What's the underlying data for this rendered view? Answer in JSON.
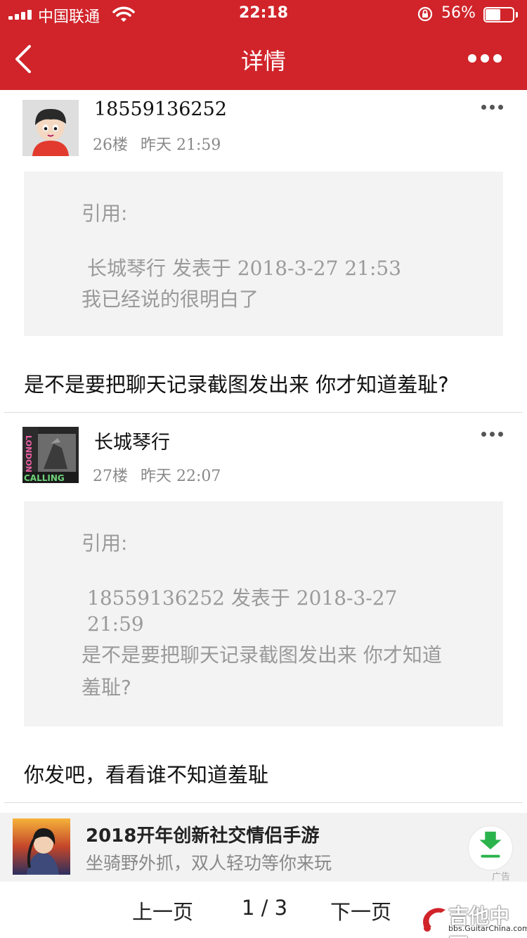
{
  "status": {
    "carrier": "中国联通",
    "time": "22:18",
    "battery": "56%",
    "battery_level": 0.56
  },
  "header": {
    "title": "详情"
  },
  "posts": [
    {
      "author": "18559136252",
      "floor": "26楼",
      "time": "昨天 21:59",
      "quote_label": "引用:",
      "quote_source": "长城琴行 发表于 2018-3-27 21:53",
      "quote_text": "我已经说的很明白了",
      "body": "是不是要把聊天记录截图发出来 你才知道羞耻?"
    },
    {
      "author": "长城琴行",
      "floor": "27楼",
      "time": "昨天 22:07",
      "quote_label": "引用:",
      "quote_source_line1": "18559136252 发表于 2018-3-27",
      "quote_source_line2": "21:59",
      "quote_text": "是不是要把聊天记录截图发出来 你才知道羞耻?",
      "body": "你发吧，看看谁不知道羞耻"
    }
  ],
  "ad": {
    "title": "2018开年创新社交情侣手游",
    "subtitle": "坐骑野外抓，双人轻功等你来玩",
    "tag": "广告"
  },
  "pager": {
    "prev": "上一页",
    "current": "1 / 3",
    "next": "下一页"
  },
  "watermark": {
    "text": "吉他中国",
    "url": "bbs.GuitarChina.com"
  },
  "colors": {
    "header_bg": "#d0242a",
    "quote_bg": "#f3f3f3",
    "download_green": "#2bb34b"
  },
  "icons": [
    "signal-icon",
    "wifi-icon",
    "orientation-lock-icon",
    "battery-icon",
    "back-chevron-icon",
    "more-icon",
    "download-icon"
  ]
}
